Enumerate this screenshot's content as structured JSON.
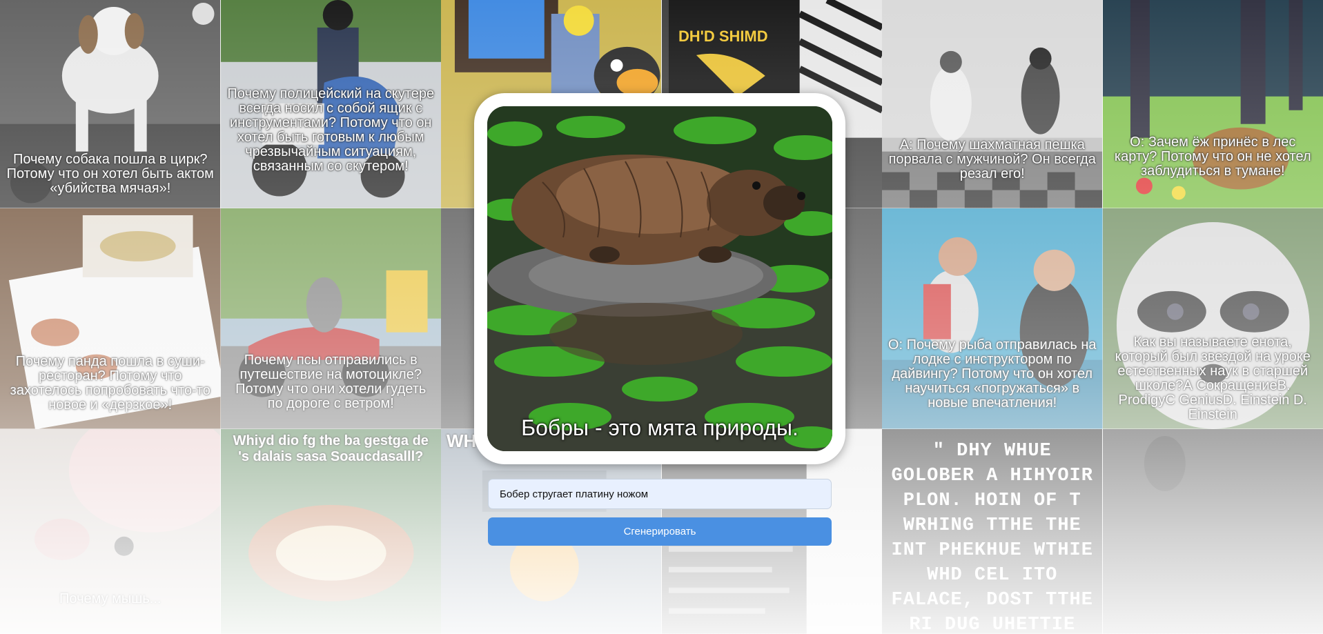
{
  "main": {
    "caption": "Бобры - это мята природы.",
    "prompt_value": "Бобер стругает платину ножом",
    "generate_label": "Сгенерировать"
  },
  "tiles": [
    {
      "caption": "Почему собака пошла в цирк? Потому что он хотел быть актом «убийства мячая»!"
    },
    {
      "caption": "Почему полицейский на скутере всегда носил с собой ящик с инструментами? Потому что он хотел быть готовым к любым чрезвычайным ситуациям, связанным со скутером!"
    },
    {
      "caption": ""
    },
    {
      "caption": ""
    },
    {
      "caption": "А: Почему шахматная пешка порвала с мужчиной? Он всегда резал его!"
    },
    {
      "caption": "О: Зачем ёж принёс в лес карту? Потому что он не хотел заблудиться в тумане!"
    },
    {
      "caption": "Почему панда пошла в суши-ресторан? Потому что захотелось попробовать что-то новое и «дерзкое»!"
    },
    {
      "caption": "Почему псы отправились в путешествие на мотоцикле? Потому что они хотели гудеть по дороге с ветром!"
    },
    {
      "caption": ""
    },
    {
      "caption": ""
    },
    {
      "caption": "О: Почему рыба отправилась на лодке с инструктором по дайвингу? Потому что он хотел научиться «погружаться» в новые впечатления!"
    },
    {
      "caption": "Как вы называете енота, который был звездой на уроке естественных наук в старшей школе?А СокращениеB. ProdigyC GeniusD. Einstein D. Einstein"
    },
    {
      "caption": "Почему мышь..."
    },
    {
      "caption": "Whiyd dio fg the ba gestga de 's dalais sasa Soaucdasalll?"
    },
    {
      "caption": "WH"
    },
    {
      "caption": ""
    },
    {
      "caption": "\" DHY WHUE GOLOBER A HIHYOIR PLON. HOIN OF T WRHING TTHE THE INT PHEKHUE WTHIE WHD CEL ITO FALACE, DOST TTHE RI DUG UHETTIE CONNT!\""
    },
    {
      "caption": ""
    }
  ],
  "colors": {
    "button": "#4a90e2",
    "input_bg": "#e8f0fe"
  }
}
